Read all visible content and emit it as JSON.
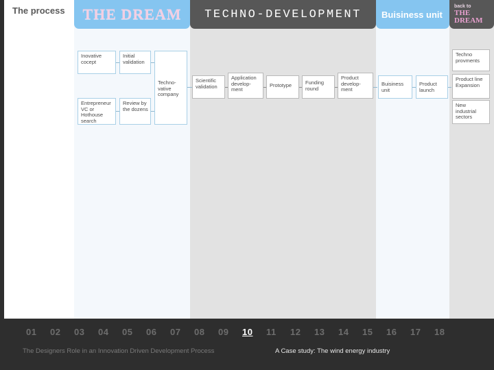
{
  "slide": {
    "process_label": "The process",
    "page_number_active": "10"
  },
  "header": {
    "tabs": [
      {
        "id": "dream",
        "label": "THE DREAM"
      },
      {
        "id": "techno",
        "label": "TECHNO-DEVELOPMENT"
      },
      {
        "id": "biz",
        "label": "Buisiness unit"
      },
      {
        "id": "back",
        "label_small": "back to",
        "label_big": "THE\nDREAM",
        "label_big_line1": "THE",
        "label_big_line2": "DREAM"
      }
    ]
  },
  "flow": {
    "dream_boxes": [
      {
        "id": "inovative-cocept",
        "text": "Inovative cocept"
      },
      {
        "id": "initial-validation",
        "text": "Initial validation"
      },
      {
        "id": "entrepreneur-search",
        "text": "Entrepreneur VC or Hothouse search"
      },
      {
        "id": "review-by-dozens",
        "text": "Review by the dozens"
      },
      {
        "id": "technovative-company",
        "text": "Techno-vative company"
      }
    ],
    "techno_boxes": [
      {
        "id": "scientific-validation",
        "text": "Scientific validation"
      },
      {
        "id": "application-development",
        "text": "Application develop-ment"
      },
      {
        "id": "prototype",
        "text": "Prototype"
      },
      {
        "id": "funding-round",
        "text": "Funding round"
      },
      {
        "id": "product-development",
        "text": "Product develop-ment"
      }
    ],
    "biz_boxes": [
      {
        "id": "buisiness-unit",
        "text": "Buisiness unit"
      },
      {
        "id": "product-launch",
        "text": "Product launch"
      }
    ],
    "outcome_boxes": [
      {
        "id": "techno-provments",
        "text": "Techno provments"
      },
      {
        "id": "product-line-expansion",
        "text": "Product line Expansion"
      },
      {
        "id": "new-industrial-sectors",
        "text": "New industrial sectors"
      }
    ]
  },
  "footer": {
    "pages": [
      "01",
      "02",
      "03",
      "04",
      "05",
      "06",
      "07",
      "08",
      "09",
      "10",
      "11",
      "12",
      "13",
      "14",
      "15",
      "16",
      "17",
      "18"
    ],
    "left_text": "The Designers Role in an Innovation Driven Development Process",
    "right_text": "A Case study: The wind energy industry"
  },
  "colors": {
    "tab_blue": "#85c5f0",
    "tab_dark": "#575757",
    "band_light": "#f4f8fc",
    "band_gray": "#e2e2e2",
    "footer_bg": "#2e2e2e",
    "accent_pink": "#e8a0cf"
  }
}
